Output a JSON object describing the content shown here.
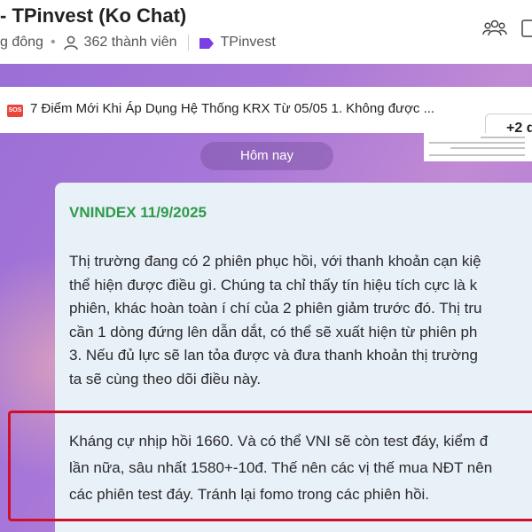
{
  "header": {
    "title": "- TPinvest (Ko Chat)",
    "status": "g đông",
    "members": "362 thành viên",
    "tag": "TPinvest"
  },
  "pinned": {
    "badge": "SOS",
    "text": "7 Điểm Mới Khi Áp Dụng Hệ Thống KRX Từ 05/05 1. Không được ...",
    "more": "+2 g"
  },
  "date_separator": "Hôm nay",
  "message": {
    "title": "VNINDEX 11/9/2025",
    "paragraph1": [
      "Thị trường đang có 2 phiên phục hồi, với thanh khoản cạn kiệ",
      "thể hiện được điều gì. Chúng ta chỉ thấy tín hiệu tích cực là k",
      "phiên, khác hoàn toàn í chí của 2 phiên giảm trước đó. Thị tru",
      "cần 1 dòng đứng lên dẫn dắt, có thể sẽ xuất hiện từ phiên ph",
      "3. Nếu đủ lực sẽ lan tỏa được và đưa thanh khoản thị trường",
      "ta sẽ cùng theo dõi điều này."
    ],
    "paragraph2": [
      "Kháng cự nhịp hồi 1660. Và có thể VNI sẽ còn test đáy, kiểm đ",
      "lần nữa, sâu nhất 1580+-10đ. Thế nên các vị thế mua NĐT nên",
      "các phiên test đáy. Tránh lại fomo trong các phiên hồi."
    ]
  },
  "colors": {
    "accent_green": "#2e9b4a",
    "highlight_red": "#d0102a",
    "tag_purple": "#7b3fe4",
    "chat_bg": "#a777d8"
  }
}
